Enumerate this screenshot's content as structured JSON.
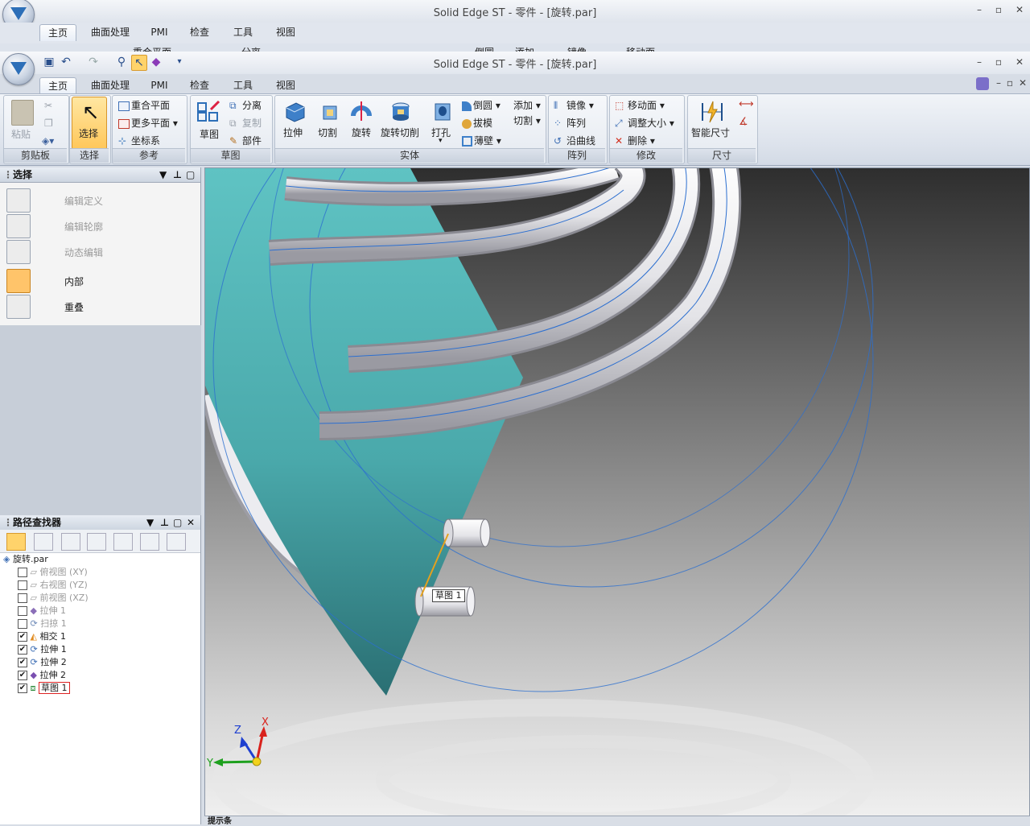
{
  "window": {
    "title": "Solid Edge ST - 零件 - [旋转.par]"
  },
  "tabs": [
    "主页",
    "曲面处理",
    "PMI",
    "检查",
    "工具",
    "视图"
  ],
  "ghost_strip": {
    "items": [
      "重合平面",
      "分离",
      "倒圆",
      "添加",
      "镜像",
      "移动面"
    ]
  },
  "ribbon": {
    "clipboard": {
      "paste": "粘贴",
      "label": "剪贴板"
    },
    "select": {
      "button": "选择",
      "label": "选择"
    },
    "reference": {
      "items": [
        "重合平面",
        "更多平面",
        "坐标系"
      ],
      "label": "参考"
    },
    "sketch": {
      "big": "草图",
      "items": [
        "分离",
        "复制",
        "部件"
      ],
      "label": "草图"
    },
    "solid": {
      "big": [
        "拉伸",
        "切割",
        "旋转",
        "旋转切削",
        "打孔"
      ],
      "small": [
        "倒圆",
        "拔模",
        "薄壁"
      ],
      "add": "添加",
      "cut": "切割",
      "label": "实体"
    },
    "pattern": {
      "items": [
        "镜像",
        "阵列",
        "沿曲线"
      ],
      "label": "阵列"
    },
    "modify": {
      "items": [
        "移动面",
        "调整大小",
        "删除"
      ],
      "label": "修改"
    },
    "dimension": {
      "big": "智能尺寸",
      "label": "尺寸"
    }
  },
  "select_panel": {
    "title": "选择",
    "commands": [
      {
        "label": "编辑定义",
        "enabled": false,
        "active": false
      },
      {
        "label": "编辑轮廓",
        "enabled": false,
        "active": false
      },
      {
        "label": "动态编辑",
        "enabled": false,
        "active": false
      },
      {
        "label": "内部",
        "enabled": true,
        "active": true
      },
      {
        "label": "重叠",
        "enabled": true,
        "active": false
      }
    ]
  },
  "pathfinder": {
    "title": "路径查找器",
    "root": "旋转.par",
    "items": [
      {
        "label": "俯视图 (XY)",
        "checked": false,
        "dim": true
      },
      {
        "label": "右视图 (YZ)",
        "checked": false,
        "dim": true
      },
      {
        "label": "前视图 (XZ)",
        "checked": false,
        "dim": true
      },
      {
        "label": "拉伸 1",
        "checked": false,
        "dim": true
      },
      {
        "label": "扫掠 1",
        "checked": false,
        "dim": true
      },
      {
        "label": "相交 1",
        "checked": true,
        "dim": false
      },
      {
        "label": "拉伸 1",
        "checked": true,
        "dim": false
      },
      {
        "label": "拉伸 2",
        "checked": true,
        "dim": false
      },
      {
        "label": "拉伸 2",
        "checked": true,
        "dim": false
      },
      {
        "label": "草图 1",
        "checked": true,
        "dim": false,
        "selected": true
      }
    ]
  },
  "viewport": {
    "sketch_tag": "草图 1",
    "axes": {
      "x": "X",
      "y": "Y",
      "z": "Z"
    }
  },
  "status_bar": {
    "label": "提示条"
  },
  "colors": {
    "accent": "#ffc75a",
    "plane": "#5fc3c3",
    "axis_x": "#d9221c",
    "axis_y": "#1ea01e",
    "axis_z": "#1e3fd0"
  }
}
